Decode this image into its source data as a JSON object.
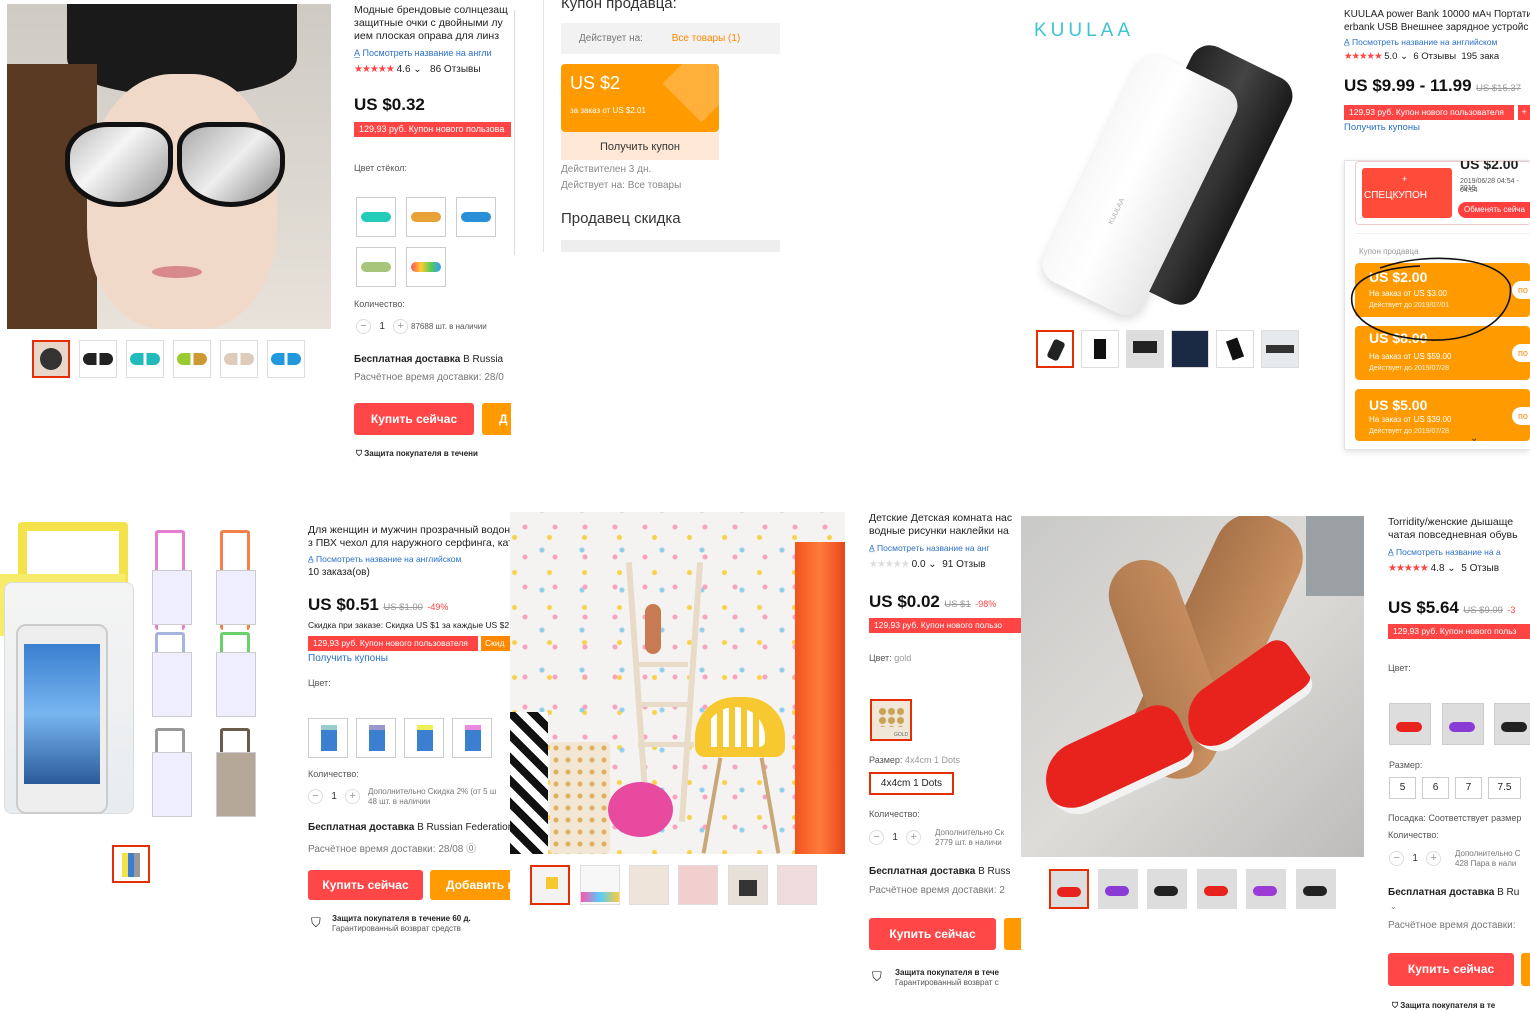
{
  "p1": {
    "title_l1": "Модные брендовые солнцезащ",
    "title_l2": "защитные очки с двойными лу",
    "title_l3": "ием плоская оправа для линз",
    "see_en": "Посмотреть название на англи",
    "rating": "4.6",
    "reviews": "86 Отзывы",
    "price": "US $0.32",
    "coupon": "129,93 руб. Купон нового пользова",
    "color_label": "Цвет стёкол:",
    "qty_label": "Количество:",
    "qty": "1",
    "stock": "87688 шт. в наличии",
    "ship_bold": "Бесплатная доставка",
    "ship_rest": "В Russia",
    "eta": "Расчётное время доставки: 28/0",
    "buy": "Купить сейчас",
    "add": "Д",
    "protect": "Защита покупателя в течени"
  },
  "p2": {
    "header": "Купон продавца:",
    "valid_label": "Действует на:",
    "valid_value": "Все товары (1)",
    "coupon_amount": "US $2",
    "coupon_min": "за заказ от US $2.01",
    "get": "Получить купон",
    "valid_days": "Действителен 3 дн.",
    "applies": "Действует на: Все товары",
    "discount": "Продавец скидка"
  },
  "p3": {
    "brand": "KUULAA",
    "brand_small": "KUULAA"
  },
  "p4": {
    "title_l1": "KUULAA power Bank 10000 мАч Портати",
    "title_l2": "erbank USB Внешнее зарядное устройс",
    "see_en": "Посмотреть название на английском",
    "rating": "5.0",
    "reviews": "6 Отзывы",
    "orders": "195 зака",
    "price": "US $9.99 - 11.99",
    "old": "US $15.37",
    "coupon": "129,93 руб. Купон нового пользователя",
    "coupon_plus": "+",
    "get_coupons": "Получить купоны",
    "special_amount": "US $2.00",
    "special_label": "СПЕЦКУПОН",
    "special_plus": "+",
    "special_date1": "2019/06/28 04:54 - 2019",
    "special_date2": "04:54",
    "exchange": "Обменять сейча",
    "seller_label": "Купон продавца",
    "coupons": [
      {
        "value": "US $2.00",
        "amount": "На заказ от  US $3.00",
        "date": "Действует до 2019/07/01",
        "btn": "по"
      },
      {
        "value": "US $8.00",
        "amount": "На заказ от  US $59.00",
        "date": "Действует до 2019/07/28",
        "btn": "по"
      },
      {
        "value": "US $5.00",
        "amount": "На заказ от  US $39.00",
        "date": "Действует до 2019/07/28",
        "btn": "по"
      }
    ]
  },
  "p6": {
    "title_l1": "Для женщин и мужчин прозрачный водон",
    "title_l2": "з ПВХ чехол для наружного серфинга, ката",
    "see_en": "Посмотреть название на английском",
    "orders": "10 заказа(ов)",
    "price": "US $0.51",
    "old": "US $1.00",
    "disc": "-49%",
    "order_disc": "Скидка при заказе: Скидка US $1 за каждые US $2",
    "coupon": "129,93 руб. Купон нового пользователя",
    "coupon2": "Скид",
    "get_coupons": "Получить купоны",
    "color_label": "Цвет:",
    "qty_label": "Количество:",
    "qty": "1",
    "extra1": "Дополнительно Скидка 2% (от 5 ш",
    "extra2": "48 шт. в наличии",
    "ship_bold": "Бесплатная доставка",
    "ship_rest": "В Russian Federation",
    "eta": "Расчётное время доставки: 28/08",
    "buy": "Купить сейчас",
    "add": "Добавить в",
    "protect1": "Защита покупателя в течение 60 д.",
    "protect2": "Гарантированный возврат средств"
  },
  "p8": {
    "title_l1": "Детские Детская комната нас",
    "title_l2": "водные рисунки наклейки на",
    "see_en": "Посмотреть название на анг",
    "rating": "0.0",
    "reviews": "91 Отзыв",
    "price": "US $0.02",
    "old": "US $1",
    "disc": "-98%",
    "coupon": "129,93 руб. Купон нового пользо",
    "color_label": "Цвет:",
    "color_value": "gold",
    "gold": "GOLD",
    "size_label": "Размер:",
    "size_value": "4x4cm 1 Dots",
    "size_opt": "4x4cm 1 Dots",
    "qty_label": "Количество:",
    "qty": "1",
    "extra1": "Дополнительно Ск",
    "extra2": "2779 шт. в наличи",
    "ship_bold": "Бесплатная доставка",
    "ship_rest": "В Russ",
    "eta": "Расчётное время доставки: 2",
    "buy": "Купить сейчас",
    "protect1": "Защита покупателя в тече",
    "protect2": "Гарантированный возврат с"
  },
  "p10": {
    "title_l1": "Torridity/женские дышаще",
    "title_l2": "чатая повседневная обувь",
    "see_en": "Посмотреть название на а",
    "rating": "4.8",
    "reviews": "5 Отзыв",
    "price": "US $5.64",
    "old": "US $9.09",
    "disc": "-3",
    "coupon": "129,93 руб. Купон нового польз",
    "color_label": "Цвет:",
    "size_label": "Размер:",
    "sizes": [
      "5",
      "6",
      "7",
      "7.5"
    ],
    "fit": "Посадка: Соответствует размер",
    "qty_label": "Количество:",
    "qty": "1",
    "extra1": "Дополнительно С",
    "extra2": "428 Пара в нали",
    "ship_bold": "Бесплатная доставка",
    "ship_rest": "В Ru",
    "eta": "Расчётное время доставки:",
    "buy": "Купить сейчас",
    "protect": "Защита покупателя в те"
  },
  "colors": {
    "red": "#ff4747",
    "orange": "#ff9a00",
    "link": "#2b70c9",
    "brand": "#3ec3d3"
  }
}
